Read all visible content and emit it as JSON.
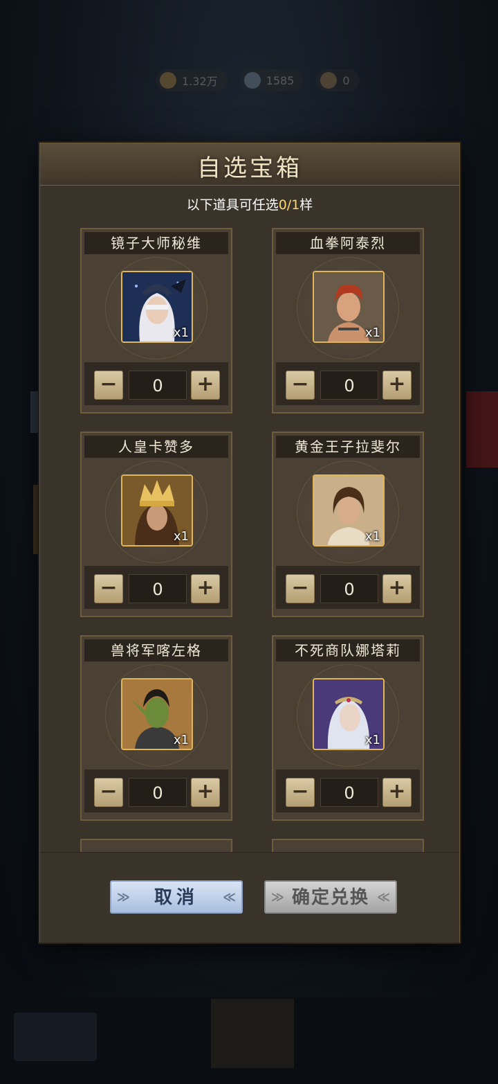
{
  "background": {
    "resources": [
      {
        "icon": "gold-coin-icon",
        "value": "1.32万"
      },
      {
        "icon": "gem-icon",
        "value": "1585"
      },
      {
        "icon": "token-icon",
        "value": "0"
      }
    ],
    "bottom_tabs": [
      "",
      "",
      ""
    ]
  },
  "dialog": {
    "title": "自选宝箱",
    "subtitle_prefix": "以下道具可任选",
    "subtitle_count": "0/1",
    "subtitle_suffix": "样",
    "items": [
      {
        "name": "镜子大师秘维",
        "quantity": "x1",
        "value": "0",
        "minus": "−",
        "plus": "+",
        "icon": "portrait-white-hair-icon"
      },
      {
        "name": "血拳阿泰烈",
        "quantity": "x1",
        "value": "0",
        "minus": "−",
        "plus": "+",
        "icon": "portrait-red-hair-icon"
      },
      {
        "name": "人皇卡赞多",
        "quantity": "x1",
        "value": "0",
        "minus": "−",
        "plus": "+",
        "icon": "portrait-gold-crown-icon"
      },
      {
        "name": "黄金王子拉斐尔",
        "quantity": "x1",
        "value": "0",
        "minus": "−",
        "plus": "+",
        "icon": "portrait-brown-hair-icon"
      },
      {
        "name": "兽将军喀左格",
        "quantity": "x1",
        "value": "0",
        "minus": "−",
        "plus": "+",
        "icon": "portrait-orc-icon"
      },
      {
        "name": "不死商队娜塔莉",
        "quantity": "x1",
        "value": "0",
        "minus": "−",
        "plus": "+",
        "icon": "portrait-silver-hair-icon"
      }
    ],
    "cancel_label": "取消",
    "confirm_label": "确定兑换"
  },
  "colors": {
    "accent_gold": "#ffd76a",
    "panel": "#3a332a",
    "cancel_blue": "#a9bfe0",
    "confirm_disabled": "#a4a4a4"
  }
}
